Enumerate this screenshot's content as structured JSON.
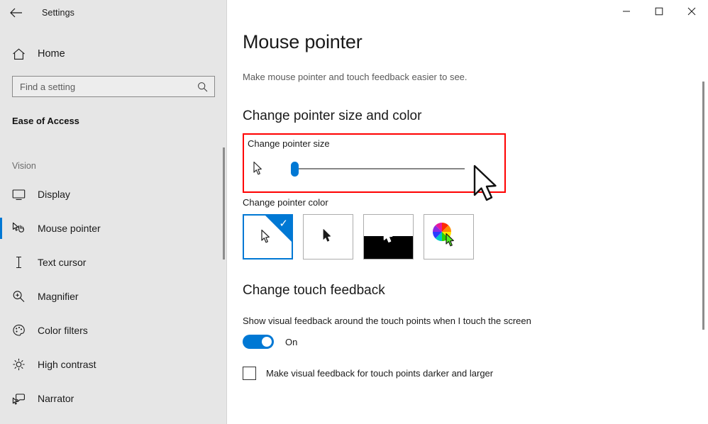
{
  "titlebar": {
    "back_icon": "back-arrow-icon",
    "app_title": "Settings",
    "minimize_label": "—",
    "maximize_label": "□",
    "close_label": "✕"
  },
  "sidebar": {
    "home_label": "Home",
    "home_icon": "home-icon",
    "search": {
      "placeholder": "Find a setting",
      "value": "",
      "icon": "search-icon"
    },
    "section_title": "Ease of Access",
    "group_label": "Vision",
    "items": [
      {
        "label": "Display",
        "icon": "monitor-icon",
        "selected": false
      },
      {
        "label": "Mouse pointer",
        "icon": "mouse-pointer-hand-icon",
        "selected": true
      },
      {
        "label": "Text cursor",
        "icon": "text-cursor-icon",
        "selected": false
      },
      {
        "label": "Magnifier",
        "icon": "magnifier-icon",
        "selected": false
      },
      {
        "label": "Color filters",
        "icon": "palette-icon",
        "selected": false
      },
      {
        "label": "High contrast",
        "icon": "brightness-icon",
        "selected": false
      },
      {
        "label": "Narrator",
        "icon": "narrator-icon",
        "selected": false
      }
    ]
  },
  "main": {
    "page_title": "Mouse pointer",
    "page_subtitle": "Make mouse pointer and touch feedback easier to see.",
    "size_color_heading": "Change pointer size and color",
    "pointer_size": {
      "label": "Change pointer size",
      "value": 1,
      "min": 1,
      "max": 15,
      "highlight_color": "#ff0000"
    },
    "pointer_color": {
      "label": "Change pointer color",
      "options": [
        {
          "name": "white-pointer",
          "selected": true
        },
        {
          "name": "black-pointer",
          "selected": false
        },
        {
          "name": "inverted-pointer",
          "selected": false
        },
        {
          "name": "custom-color-pointer",
          "selected": false
        }
      ]
    },
    "touch_feedback": {
      "heading": "Change touch feedback",
      "toggle_description": "Show visual feedback around the touch points when I touch the screen",
      "toggle_state": "On",
      "checkbox_label": "Make visual feedback for touch points darker and larger",
      "checkbox_checked": false
    }
  },
  "colors": {
    "accent": "#0078d4",
    "sidebar_bg": "#e6e6e6",
    "highlight": "#ff0000"
  }
}
